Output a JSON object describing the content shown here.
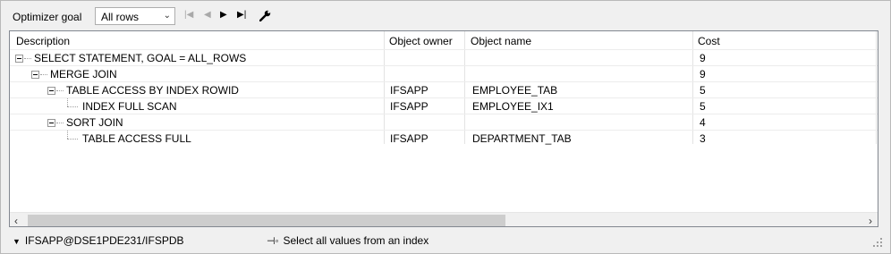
{
  "toolbar": {
    "optimizer_label": "Optimizer goal",
    "optimizer_value": "All rows",
    "nav": [
      "first",
      "previous",
      "next",
      "last"
    ],
    "settings_icon": "wrench-icon"
  },
  "grid": {
    "columns": [
      "Description",
      "Object owner",
      "Object name",
      "Cost"
    ],
    "rows": [
      {
        "description": "SELECT STATEMENT, GOAL = ALL_ROWS",
        "owner": "",
        "name": "",
        "cost": "9",
        "level": 0,
        "expandable": true
      },
      {
        "description": "MERGE JOIN",
        "owner": "",
        "name": "",
        "cost": "9",
        "level": 1,
        "expandable": true
      },
      {
        "description": "TABLE ACCESS BY INDEX ROWID",
        "owner": "IFSAPP",
        "name": "EMPLOYEE_TAB",
        "cost": "5",
        "level": 2,
        "expandable": true
      },
      {
        "description": "INDEX FULL SCAN",
        "owner": "IFSAPP",
        "name": "EMPLOYEE_IX1",
        "cost": "5",
        "level": 3,
        "expandable": false
      },
      {
        "description": "SORT JOIN",
        "owner": "",
        "name": "",
        "cost": "4",
        "level": 2,
        "expandable": true
      },
      {
        "description": "TABLE ACCESS FULL",
        "owner": "IFSAPP",
        "name": "DEPARTMENT_TAB",
        "cost": "3",
        "level": 3,
        "expandable": false
      }
    ]
  },
  "status": {
    "connection": "IFSAPP@DSE1PDE231/IFSPDB",
    "hint": "Select all values from an index"
  }
}
